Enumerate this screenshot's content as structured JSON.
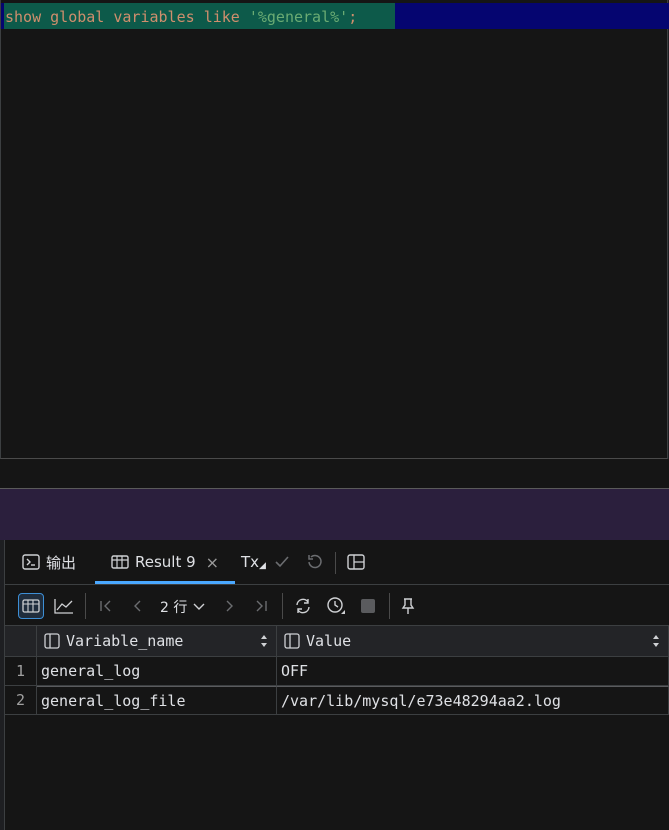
{
  "editor": {
    "query_kw1": "show",
    "query_kw2": "global",
    "query_kw3": "variables",
    "query_kw4": "like",
    "query_str": "'%general%'",
    "query_end": ";"
  },
  "tabs": {
    "output_label": "输出",
    "result_label": "Result 9",
    "tx_label": "Tx"
  },
  "toolbar": {
    "rows_label": "2 行"
  },
  "grid": {
    "columns": [
      "Variable_name",
      "Value"
    ],
    "rows": [
      {
        "num": "1",
        "name": "general_log",
        "value": "OFF"
      },
      {
        "num": "2",
        "name": "general_log_file",
        "value": "/var/lib/mysql/e73e48294aa2.log"
      }
    ]
  },
  "colors": {
    "accent": "#4aa8ff",
    "keyword": "#cf8e6d",
    "string": "#6aab73"
  }
}
